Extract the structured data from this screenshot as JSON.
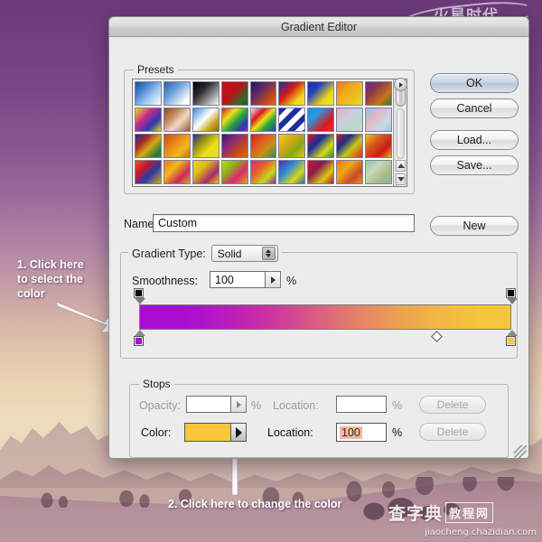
{
  "window": {
    "title": "Gradient Editor"
  },
  "presets": {
    "legend": "Presets",
    "disclosure_icon": "triangle-right-icon",
    "scrollbar": {
      "up_icon": "triangle-up-icon",
      "down_icon": "triangle-down-icon"
    },
    "swatches": [
      "linear-gradient(135deg,#1e4f96,#3f7fd0 28%,#9dc4ec 60%,#ffffff)",
      "linear-gradient(135deg,#2a5fa8,#6fa5dd 40%,rgba(255,255,255,0) 85%)",
      "linear-gradient(135deg,#000000,#2a2a2a 35%,#9a9a9a 70%,#ffffff)",
      "linear-gradient(135deg,#d10a16,#b8141c 45%,#2f6b2a 80%,#1d5a22)",
      "linear-gradient(135deg,#2b1352,#5a2a6e 35%,#c24a18 75%,#e86a14)",
      "linear-gradient(135deg,#1c2fa8,#d01a1a 40%,#f0d018 75%,#f6e43a)",
      "linear-gradient(135deg,#1b2ea6,#2440c0 30%,#e8d617 70%,#f2e43c)",
      "linear-gradient(135deg,#f07a14,#f4a820 40%,#e8c81c 75%,#efdc3a)",
      "linear-gradient(135deg,#6b2a8e,#8c3a46 35%,#c87418 70%,#2f7a2c)",
      "linear-gradient(135deg,#f2d81c,#c42a8c 38%,#2a3ab0 70%,#f0d21c)",
      "linear-gradient(135deg,#8a4a1c,#c89060 35%,#f0dcc8 60%,#a05a28)",
      "linear-gradient(135deg,#2f8fd8,#ffffff 45%,#c8a020 75%,#8a6a14)",
      "linear-gradient(135deg,#d81820,#f0e018 30%,#2aa83a 55%,#2a3ab8 80%,#8a2ab0)",
      "linear-gradient(135deg,#e8e8e8,#d81820 30%,#f0e018 50%,#2aa83a 70%,#2a3ab8)",
      "repeating-linear-gradient(135deg,#1c2f9e 0 6px,#ffffff 6px 12px)",
      "linear-gradient(135deg,#1a8ad8,#2a9ae0 30%,#d81820 70%,#e02a2a)",
      "linear-gradient(135deg,#e8b0b8,#c8d0e0 40%,#b8d8c8 75%,#e0c8d0)",
      "linear-gradient(135deg,#88c8e0,#e0b8c0 35%,#c8d8e8 70%,#a8c8d8)",
      "linear-gradient(135deg,#1a2a8e,#a82a2a 30%,#d8a818 55%,#2a7a3a 85%)",
      "linear-gradient(135deg,#c84a10,#e88a18 40%,#f0b820 70%,#c86a10)",
      "linear-gradient(135deg,#1a2a9e,#8a8a18 30%,#f0e018 65%,#e8d81c)",
      "linear-gradient(135deg,#3a1860,#8a2a7a 35%,#c84a18 70%,#e06a10)",
      "linear-gradient(135deg,#d81820,#e0581c 35%,#c89018 65%,#2a8a6a)",
      "linear-gradient(135deg,#e8d818,#d8a818 35%,#8aa818 65%,#d8c818)",
      "linear-gradient(135deg,#d81820,#1a2a9e 35%,#d8d818 70%,#2a8a3a)",
      "linear-gradient(135deg,#d81820,#1a2a8e 30%,#c8c818 60%,#d82a2a)",
      "linear-gradient(135deg,#f0c018,#d85a18 35%,#c81a1a 70%,#e8a818)",
      "linear-gradient(135deg,#e85a18,#c81a2a 30%,#2a3aa8 60%,#d8a818)",
      "linear-gradient(135deg,#e87a18,#f0b81c 35%,#c82a5a 70%,#e0a818)",
      "linear-gradient(135deg,#f0d818,#d8b818 35%,#a82a6a 70%,#e8c818)",
      "linear-gradient(135deg,#c8d818,#8ab818 30%,#d82a6a 65%,#e0a818)",
      "linear-gradient(135deg,#d82a8a,#e85a2a 35%,#c8d818 70%,#8a2a9e)",
      "linear-gradient(135deg,#5a2a9e,#2a8ad8 35%,#d8d818 70%,#2a6ab8)",
      "linear-gradient(135deg,#c81a2a,#8a1a4a 35%,#d8c818 70%,#a81a2a)",
      "linear-gradient(135deg,#e8741c,#f0a818 35%,#c84a2a 70%,#e8941c)",
      "linear-gradient(135deg,#8ac8a8,#c8d8b8 35%,#a8b888 70%,#88b898)"
    ]
  },
  "buttons": {
    "ok": "OK",
    "cancel": "Cancel",
    "load": "Load...",
    "save": "Save...",
    "new": "New"
  },
  "name_row": {
    "label": "Name:",
    "value": "Custom"
  },
  "gradient_type": {
    "label": "Gradient Type:",
    "value": "Solid",
    "stepper_icon": "stepper-up-down-icon"
  },
  "smoothness": {
    "label": "Smoothness:",
    "value": "100",
    "unit": "%",
    "arrow_icon": "triangle-right-icon"
  },
  "gradient_strip": {
    "start_color": "#a90ece",
    "end_color": "#f5c63c",
    "css": "linear-gradient(to right,#a90ece 0%,#a90ece 12%,#b318c4 20%,#c72aa8 32%,#d6508c 44%,#e27a6e 56%,#eb9c54 68%,#f2b546 80%,#f5c63c 92%,#f5c63c 100%)",
    "opacity_stops": [
      {
        "position_pct": 0,
        "color": "#0a0a0a"
      },
      {
        "position_pct": 100,
        "color": "#0a0a0a"
      }
    ],
    "color_stops": [
      {
        "position_pct": 0,
        "color": "#a90ece"
      },
      {
        "position_pct": 100,
        "color": "#f5c63c"
      }
    ],
    "midpoint_icon": "diamond-midpoint-icon"
  },
  "stops": {
    "legend": "Stops",
    "opacity": {
      "label": "Opacity:",
      "value": "",
      "unit": "%",
      "arrow_icon": "triangle-right-icon"
    },
    "location_opacity": {
      "label": "Location:",
      "value": "",
      "unit": "%"
    },
    "delete_opacity": "Delete",
    "color": {
      "label": "Color:",
      "swatch_color": "#f7c43a",
      "popup_icon": "triangle-right-icon"
    },
    "location_color": {
      "label": "Location:",
      "value": "100",
      "unit": "%",
      "highlight_color": "#f5b9a0"
    },
    "delete_color": "Delete"
  },
  "resize_grip_icon": "resize-grip-icon",
  "annotations": {
    "one": "1. Click here\nto select the\ncolor",
    "two": "2. Click here to change the color"
  },
  "watermarks": {
    "top": {
      "text": "火星时代",
      "url": "www.hxsd.com"
    },
    "bottom": {
      "text_main": "查字典",
      "text_box": "教程网",
      "url": "jiaocheng.chazidian.com"
    }
  }
}
